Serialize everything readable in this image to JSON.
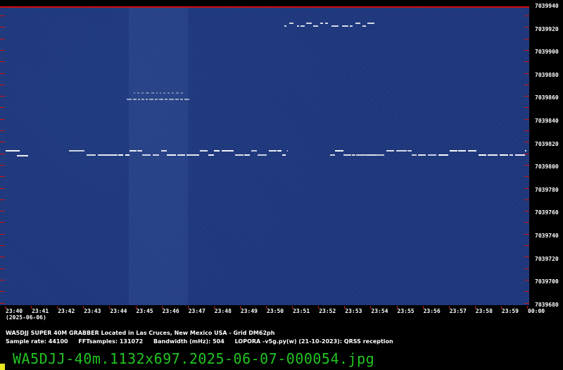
{
  "frequency_axis": {
    "labels": [
      "7039940",
      "7039920",
      "7039900",
      "7039880",
      "7039860",
      "7039840",
      "7039820",
      "7039800",
      "7039780",
      "7039760",
      "7039740",
      "7039720",
      "7039700",
      "7039680"
    ]
  },
  "time_axis": {
    "labels": [
      "23:40",
      "23:41",
      "23:42",
      "23:43",
      "23:44",
      "23:45",
      "23:46",
      "23:47",
      "23:48",
      "23:49",
      "23:50",
      "23:51",
      "23:52",
      "23:53",
      "23:54",
      "23:55",
      "23:56",
      "23:57",
      "23:58",
      "23:59",
      "00:00"
    ],
    "date": "(2025-06-06)"
  },
  "info": {
    "station_line": "WA5DJJ SUPER 40M GRABBER Located in Las Cruces, New Mexico USA - Grid DM62ph",
    "sample_rate": "Sample rate: 44100",
    "fft_samples": "FFTsamples: 131072",
    "bandwidth": "Bandwidth (mHz): 504",
    "software": "LOPORA -v5g.py(w) (21-10-2023): QRSS reception"
  },
  "filename": "WA5DJJ-40m.1132x697.2025-06-07-000054.jpg",
  "colors": {
    "waterfall_bg": "#1c3477",
    "marker_red": "#cc1010",
    "filename_green": "#22c422",
    "signal": "#ffffff"
  }
}
